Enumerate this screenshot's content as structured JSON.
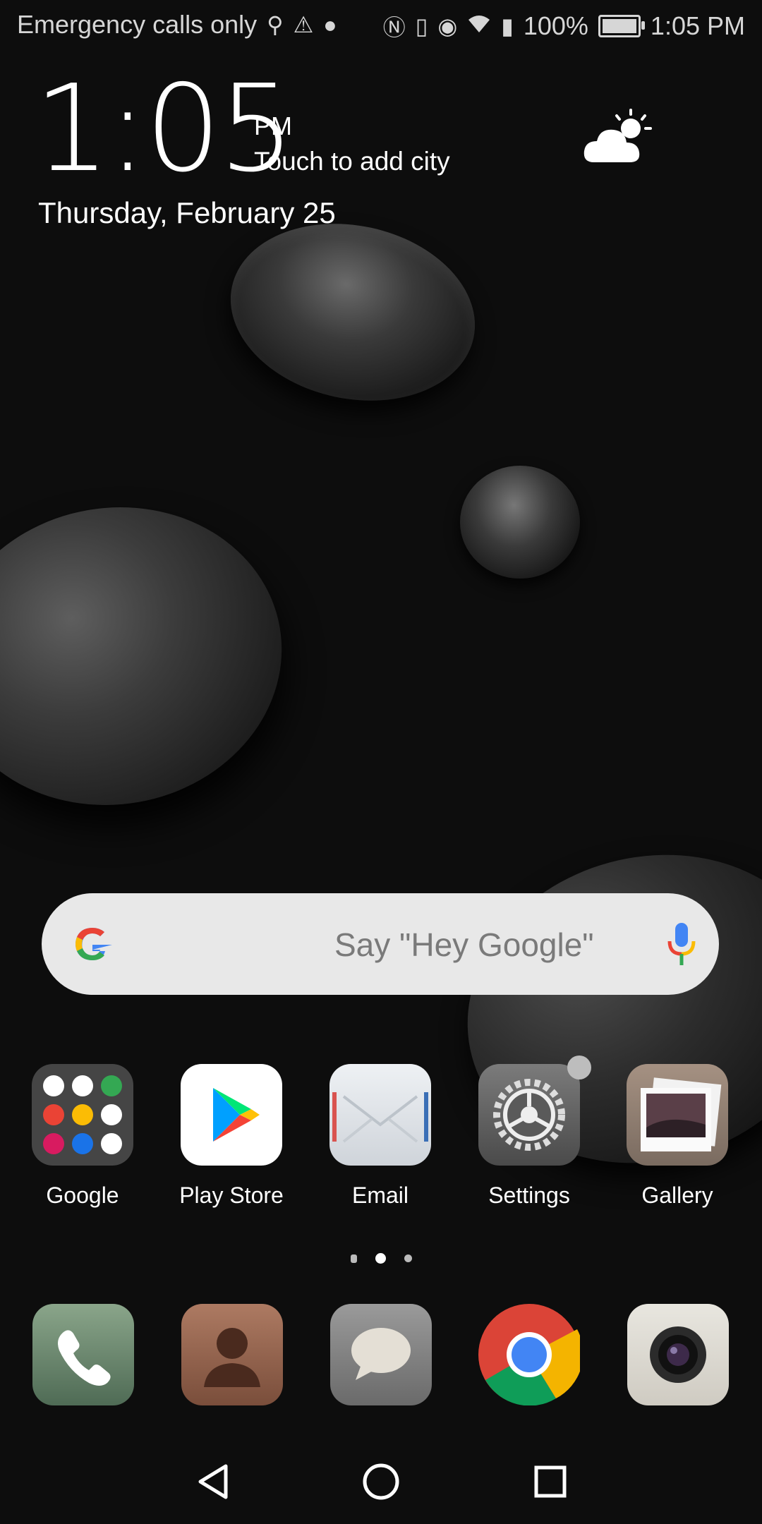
{
  "status_bar": {
    "carrier_text": "Emergency calls only",
    "battery_percent": "100%",
    "time": "1:05 PM",
    "icons_left": [
      "usb-icon",
      "warning-icon",
      "app-notification-icon"
    ],
    "icons_right": [
      "nfc-icon",
      "vibrate-icon",
      "eye-comfort-icon",
      "wifi-icon",
      "battery-saver-icon",
      "battery-charging-icon"
    ]
  },
  "clock_widget": {
    "time": "1:05",
    "ampm": "PM",
    "city_prompt": "Touch to add city",
    "date": "Thursday, February 25",
    "weather_icon": "partly-cloudy-icon"
  },
  "search_bar": {
    "placeholder": "Say \"Hey Google\""
  },
  "apps": [
    {
      "label": "Google"
    },
    {
      "label": "Play Store"
    },
    {
      "label": "Email"
    },
    {
      "label": "Settings"
    },
    {
      "label": "Gallery"
    }
  ],
  "pager": {
    "pages": 3,
    "active_index": 1
  },
  "dock": [
    "phone-icon",
    "contacts-icon",
    "messages-icon",
    "chrome-icon",
    "camera-icon"
  ],
  "nav": [
    "back-button",
    "home-button",
    "recents-button"
  ]
}
